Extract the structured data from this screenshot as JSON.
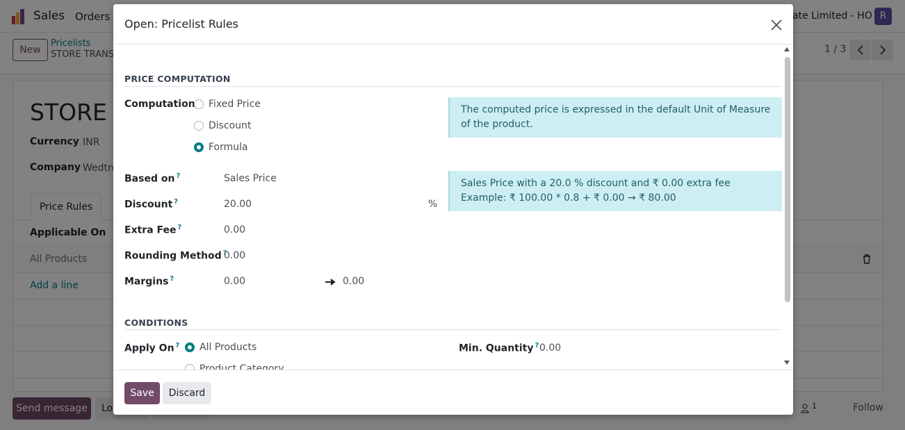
{
  "topbar": {
    "app_name": "Sales",
    "menu_orders": "Orders",
    "company": "ate Limited - HO",
    "avatar_letter": "R"
  },
  "control_panel": {
    "new_label": "New",
    "breadcrumb_parent": "Pricelists",
    "breadcrumb_current": "STORE TRANS",
    "pager": "1 / 3"
  },
  "record": {
    "title": "STORE T",
    "currency_label": "Currency",
    "currency_value": "INR",
    "company_label": "Company",
    "company_value": "Wedtre",
    "tab_price_rules": "Price Rules",
    "col_applicable_on": "Applicable On",
    "row_all_products": "All Products",
    "add_line": "Add a line"
  },
  "chatter": {
    "send_message": "Send message",
    "log_note": "Lo",
    "followers_count": "1",
    "follow": "Follow"
  },
  "modal": {
    "title": "Open: Pricelist Rules",
    "price_section": "PRICE COMPUTATION",
    "computation_label": "Computation",
    "options": [
      "Fixed Price",
      "Discount",
      "Formula"
    ],
    "uom_note": "The computed price is expressed in the default Unit of Measure of the product.",
    "based_on_label": "Based on",
    "based_on_value": "Sales Price",
    "discount_label": "Discount",
    "discount_value": "20.00",
    "discount_unit": "%",
    "formula_note_line1": "Sales Price with a 20.0 % discount and ₹ 0.00 extra fee",
    "formula_note_line2": "Example: ₹ 100.00 * 0.8 + ₹ 0.00 → ₹ 80.00",
    "extra_fee_label": "Extra Fee",
    "extra_fee_value": "0.00",
    "rounding_label": "Rounding Method",
    "rounding_value": "0.00",
    "margins_label": "Margins",
    "margin_min": "0.00",
    "margin_max": "0.00",
    "help_mark": "?",
    "conditions_section": "CONDITIONS",
    "apply_on_label": "Apply On",
    "apply_all_products": "All Products",
    "apply_product_category": "Product Category",
    "min_qty_label": "Min. Quantity",
    "min_qty_value": "0.00",
    "save_label": "Save",
    "discard_label": "Discard"
  },
  "colors": {
    "brand": "#714b67",
    "accent": "#017e84",
    "info_bg": "#cdeef2"
  }
}
